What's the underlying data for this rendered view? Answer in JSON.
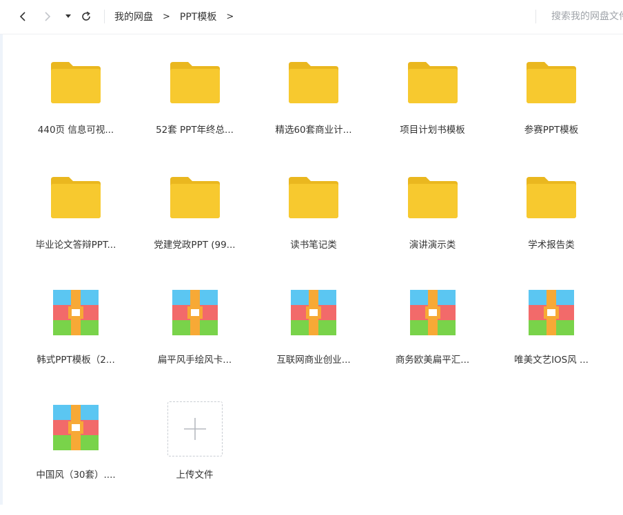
{
  "toolbar": {
    "back_icon": "chevron-left-icon",
    "forward_icon": "chevron-right-icon",
    "history_icon": "caret-down-icon",
    "refresh_icon": "refresh-icon",
    "breadcrumb": [
      "我的网盘",
      "PPT模板"
    ],
    "separator": ">",
    "search_placeholder": "搜索我的网盘文件"
  },
  "items": [
    {
      "name": "440页 信息可视...",
      "type": "folder"
    },
    {
      "name": "52套 PPT年终总...",
      "type": "folder"
    },
    {
      "name": "精选60套商业计...",
      "type": "folder"
    },
    {
      "name": "项目计划书模板",
      "type": "folder"
    },
    {
      "name": "参赛PPT模板",
      "type": "folder"
    },
    {
      "name": "毕业论文答辩PPT...",
      "type": "folder"
    },
    {
      "name": "党建党政PPT (99...",
      "type": "folder"
    },
    {
      "name": "读书笔记类",
      "type": "folder"
    },
    {
      "name": "演讲演示类",
      "type": "folder"
    },
    {
      "name": "学术报告类",
      "type": "folder"
    },
    {
      "name": "韩式PPT模板（2...",
      "type": "archive"
    },
    {
      "name": "扁平风手绘风卡...",
      "type": "archive"
    },
    {
      "name": "互联网商业创业...",
      "type": "archive"
    },
    {
      "name": "商务欧美扁平汇...",
      "type": "archive"
    },
    {
      "name": "唯美文艺IOS风 ...",
      "type": "archive"
    },
    {
      "name": "中国风（30套）....",
      "type": "archive"
    }
  ],
  "upload": {
    "label": "上传文件",
    "icon": "plus-icon"
  },
  "colors": {
    "folder": "#f7c92f",
    "folder_tab": "#eab71f",
    "archive_blue": "#5bc6f2",
    "archive_red": "#f26a6a",
    "archive_green": "#79d34a",
    "archive_band": "#f7a936"
  }
}
